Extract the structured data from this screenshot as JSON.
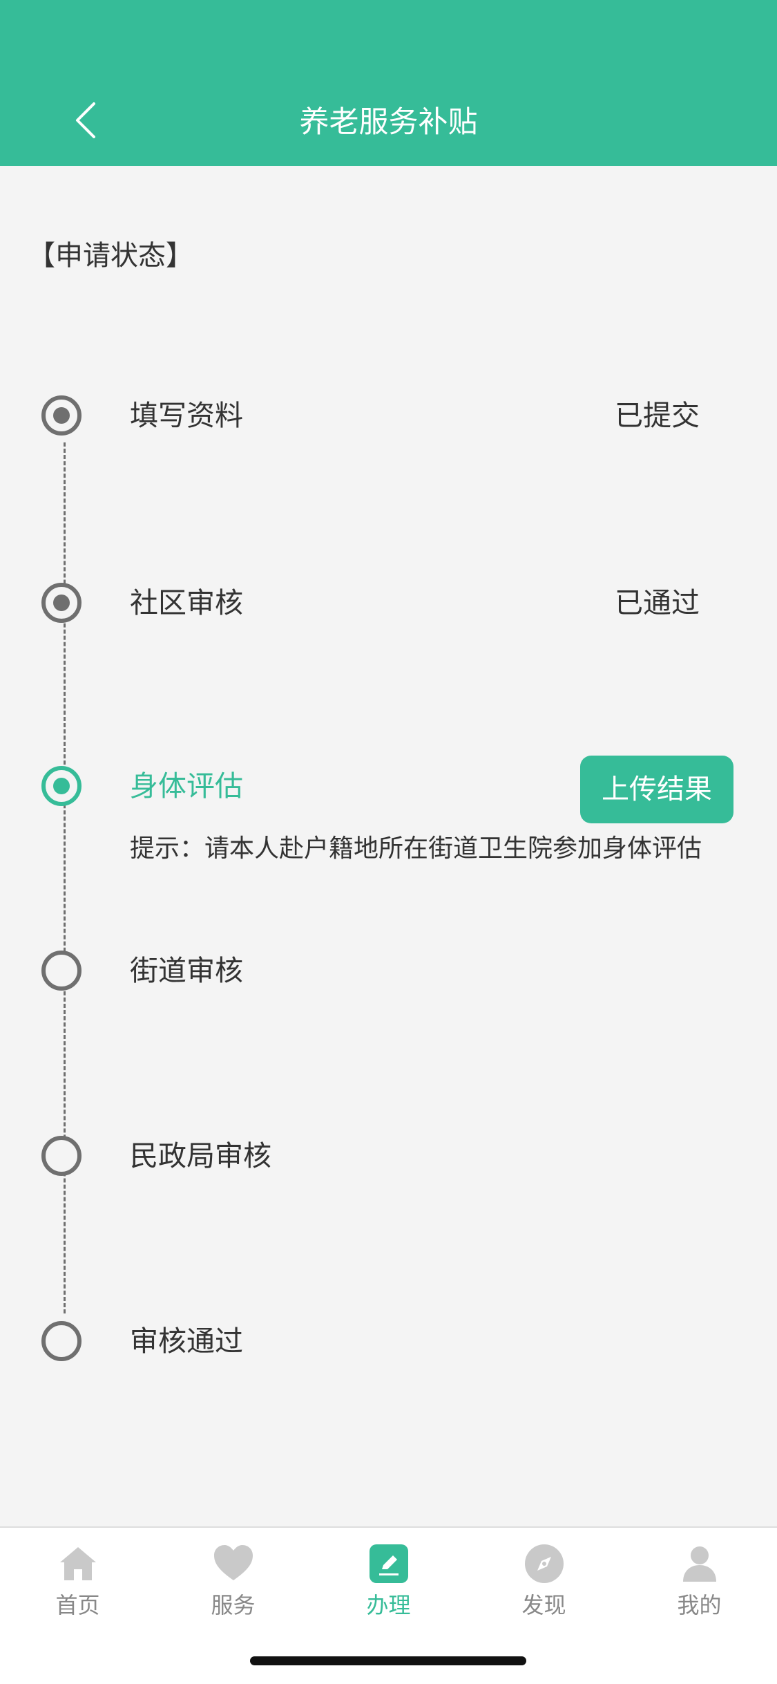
{
  "header": {
    "title": "养老服务补贴",
    "back_icon": "chevron-left-icon",
    "background_color": "#36bc98"
  },
  "section_title": "【申请状态】",
  "steps": [
    {
      "label": "填写资料",
      "status": "已提交",
      "state": "done"
    },
    {
      "label": "社区审核",
      "status": "已通过",
      "state": "done"
    },
    {
      "label": "身体评估",
      "action_label": "上传结果",
      "hint": "提示：请本人赴户籍地所在街道卫生院参加身体评估",
      "state": "current"
    },
    {
      "label": "街道审核",
      "state": "pending"
    },
    {
      "label": "民政局审核",
      "state": "pending"
    },
    {
      "label": "审核通过",
      "state": "pending"
    }
  ],
  "tabbar": {
    "items": [
      {
        "label": "首页",
        "icon": "home-icon",
        "active": false
      },
      {
        "label": "服务",
        "icon": "heart-icon",
        "active": false
      },
      {
        "label": "办理",
        "icon": "edit-icon",
        "active": true
      },
      {
        "label": "发现",
        "icon": "compass-icon",
        "active": false
      },
      {
        "label": "我的",
        "icon": "user-icon",
        "active": false
      }
    ]
  },
  "colors": {
    "accent": "#36bc98",
    "inactive": "#6f6f6f",
    "background": "#f4f4f4"
  }
}
